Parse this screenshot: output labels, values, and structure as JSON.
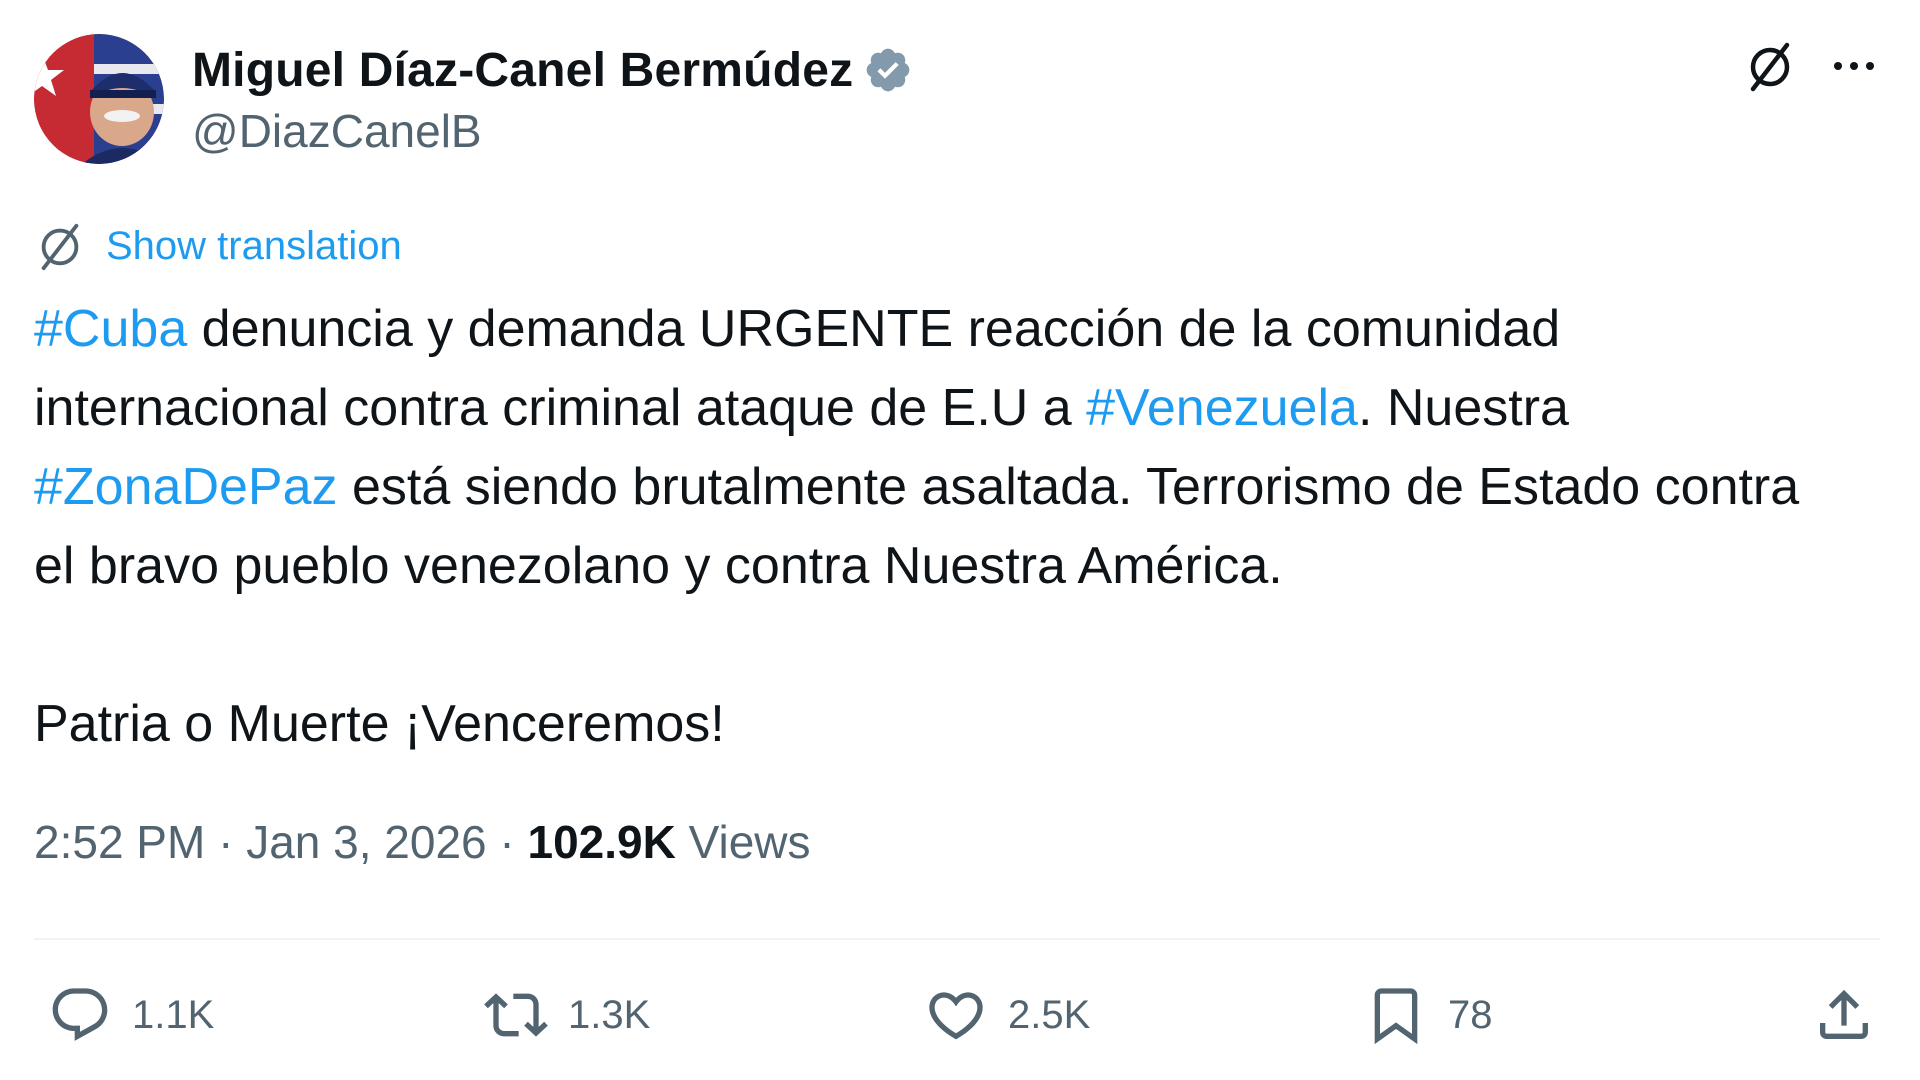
{
  "author": {
    "display_name": "Miguel Díaz-Canel Bermúdez",
    "handle": "@DiazCanelB",
    "verified": true
  },
  "translation": {
    "label": "Show translation"
  },
  "tweet": {
    "paragraphs": [
      [
        {
          "text": "#Cuba",
          "hashtag": true
        },
        {
          "text": " denuncia y demanda URGENTE reacción de la comunidad internacional contra criminal ataque de E.U a ",
          "hashtag": false
        },
        {
          "text": "#Venezuela",
          "hashtag": true
        },
        {
          "text": ". Nuestra ",
          "hashtag": false
        },
        {
          "text": "#ZonaDePaz",
          "hashtag": true
        },
        {
          "text": " está siendo brutalmente asaltada. Terrorismo de Estado contra el bravo pueblo venezolano y contra Nuestra América.",
          "hashtag": false
        }
      ],
      [
        {
          "text": "Patria o Muerte ¡Venceremos!",
          "hashtag": false
        }
      ]
    ]
  },
  "meta": {
    "time": "2:52 PM",
    "separator": " · ",
    "date": "Jan 3, 2026",
    "views_count": "102.9K",
    "views_label": " Views"
  },
  "actions": {
    "replies": "1.1K",
    "retweets": "1.3K",
    "likes": "2.5K",
    "bookmarks": "78"
  },
  "colors": {
    "accent": "#1d9bf0",
    "text_primary": "#0f1419",
    "text_secondary": "#536471",
    "verified_badge": "#829aab"
  },
  "icons": {
    "grok": "grok-icon",
    "more": "more-icon",
    "translate": "translate-icon",
    "reply": "reply-icon",
    "retweet": "retweet-icon",
    "like": "heart-icon",
    "bookmark": "bookmark-icon",
    "share": "share-icon"
  }
}
